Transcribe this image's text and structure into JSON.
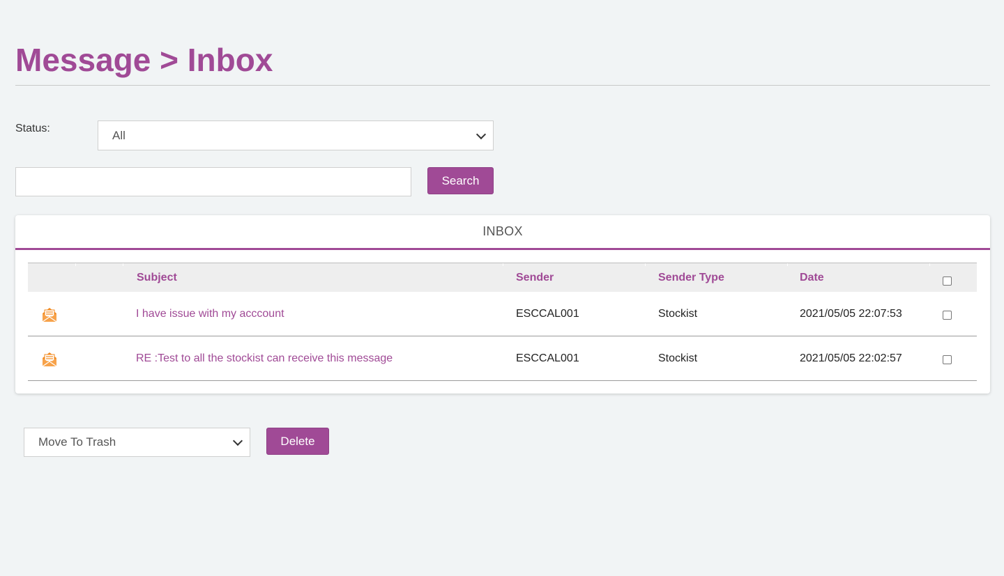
{
  "page": {
    "title": "Message > Inbox"
  },
  "filters": {
    "status_label": "Status:",
    "status_value": "All",
    "search_value": "",
    "search_button": "Search"
  },
  "inbox": {
    "header": "INBOX",
    "columns": {
      "subject": "Subject",
      "sender": "Sender",
      "sender_type": "Sender Type",
      "date": "Date"
    },
    "rows": [
      {
        "icon": "mail-open-icon",
        "subject": "I have issue with my acccount",
        "sender": "ESCCAL001",
        "sender_type": "Stockist",
        "date": "2021/05/05 22:07:53",
        "checked": false
      },
      {
        "icon": "mail-open-icon",
        "subject": "RE :Test to all the stockist can receive this message",
        "sender": "ESCCAL001",
        "sender_type": "Stockist",
        "date": "2021/05/05 22:02:57",
        "checked": false
      }
    ]
  },
  "actions": {
    "bulk_action_value": "Move To Trash",
    "delete_button": "Delete"
  },
  "colors": {
    "brand": "#a04a96",
    "icon_orange": "#f28a1f",
    "background": "#f1f4f5"
  }
}
